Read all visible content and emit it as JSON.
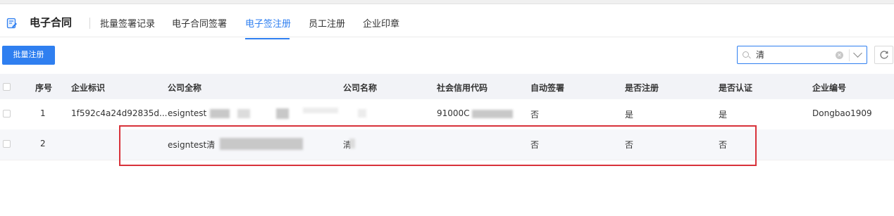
{
  "header": {
    "title": "电子合同",
    "tabs": [
      {
        "label": "批量签署记录",
        "active": false
      },
      {
        "label": "电子合同签署",
        "active": false
      },
      {
        "label": "电子签注册",
        "active": true
      },
      {
        "label": "员工注册",
        "active": false
      },
      {
        "label": "企业印章",
        "active": false
      }
    ]
  },
  "toolbar": {
    "batch_register_label": "批量注册",
    "search_value": "清"
  },
  "table": {
    "columns": [
      "序号",
      "企业标识",
      "公司全称",
      "公司名称",
      "社会信用代码",
      "自动签署",
      "是否注册",
      "是否认证",
      "企业编号"
    ],
    "rows": [
      {
        "index": "1",
        "enterprise_id": "1f592c4a24d92835d...",
        "full_name": "esigntest",
        "short_name": "",
        "credit_code": "91000C",
        "auto_sign": "否",
        "registered": "是",
        "certified": "是",
        "enterprise_no": "Dongbao1909"
      },
      {
        "index": "2",
        "enterprise_id": "",
        "full_name": "esigntest清",
        "short_name": "清",
        "credit_code": "",
        "auto_sign": "否",
        "registered": "否",
        "certified": "否",
        "enterprise_no": ""
      }
    ]
  },
  "colors": {
    "accent": "#2f7ff0",
    "highlight": "#d8323a"
  }
}
